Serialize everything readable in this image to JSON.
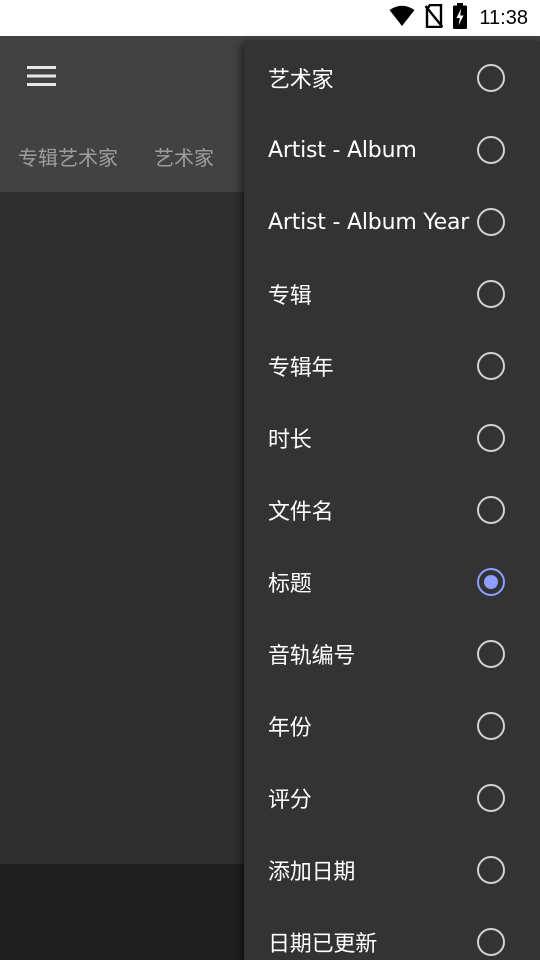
{
  "status_bar": {
    "time": "11:38",
    "icons": [
      "wifi-icon",
      "no-sim-icon",
      "battery-charging-icon"
    ]
  },
  "toolbar": {
    "menu_icon": "hamburger-menu-icon"
  },
  "tabs": [
    {
      "label": "专辑艺术家"
    },
    {
      "label": "艺术家"
    }
  ],
  "sort_menu": {
    "selected_index": 7,
    "accent_color": "#8c9eff",
    "options": [
      {
        "label": "艺术家",
        "checked": false
      },
      {
        "label": "Artist - Album",
        "checked": false
      },
      {
        "label": "Artist - Album Year",
        "checked": false
      },
      {
        "label": "专辑",
        "checked": false
      },
      {
        "label": "专辑年",
        "checked": false
      },
      {
        "label": "时长",
        "checked": false
      },
      {
        "label": "文件名",
        "checked": false
      },
      {
        "label": "标题",
        "checked": true
      },
      {
        "label": "音轨编号",
        "checked": false
      },
      {
        "label": "年份",
        "checked": false
      },
      {
        "label": "评分",
        "checked": false
      },
      {
        "label": "添加日期",
        "checked": false
      },
      {
        "label": "日期已更新",
        "checked": false
      }
    ]
  }
}
